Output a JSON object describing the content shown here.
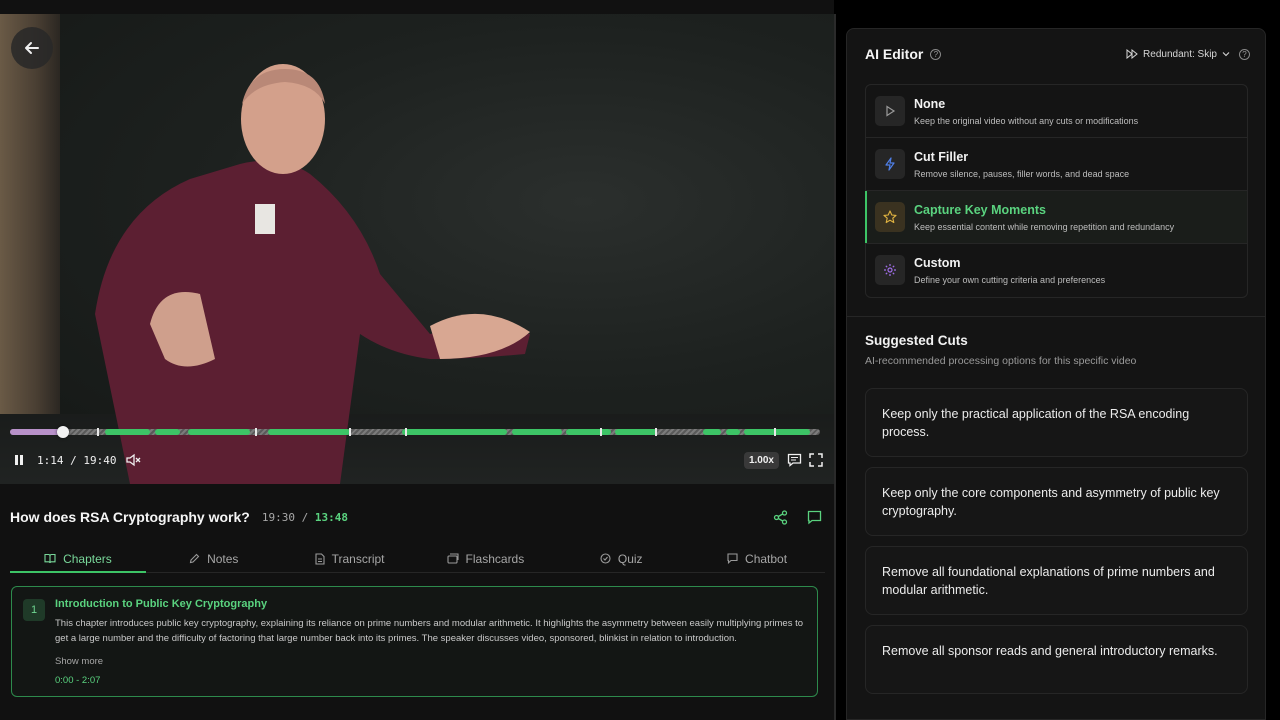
{
  "player": {
    "current_time": "1:14",
    "total_time": "19:40",
    "speed": "1.00x",
    "progress_fraction": 0.064,
    "colors": {
      "played": "#b891c9",
      "kept": "#3dc466",
      "cut": "#6b6b6b"
    }
  },
  "video": {
    "title": "How does RSA Cryptography work?",
    "original_duration": "19:30",
    "separator": "/",
    "edited_duration": "13:48"
  },
  "tabs": [
    {
      "label": "Chapters",
      "icon": "book-icon",
      "active": true
    },
    {
      "label": "Notes",
      "icon": "pencil-icon",
      "active": false
    },
    {
      "label": "Transcript",
      "icon": "document-icon",
      "active": false
    },
    {
      "label": "Flashcards",
      "icon": "cards-icon",
      "active": false
    },
    {
      "label": "Quiz",
      "icon": "check-circle-icon",
      "active": false
    },
    {
      "label": "Chatbot",
      "icon": "chat-icon",
      "active": false
    }
  ],
  "chapter": {
    "number": "1",
    "title": "Introduction to Public Key Cryptography",
    "description": "This chapter introduces public key cryptography, explaining its reliance on prime numbers and modular arithmetic. It highlights the asymmetry between easily multiplying primes to get a large number and the difficulty of factoring that large number back into its primes. The speaker discusses video, sponsored, blinkist in relation to introduction.",
    "show_more": "Show more",
    "range": "0:00 - 2:07"
  },
  "editor": {
    "title": "AI Editor",
    "redundant_label": "Redundant: Skip",
    "modes": [
      {
        "name": "None",
        "desc": "Keep the original video without any cuts or modifications",
        "icon": "play-icon",
        "color": "#9a9a9a",
        "active": false
      },
      {
        "name": "Cut Filler",
        "desc": "Remove silence, pauses, filler words, and dead space",
        "icon": "lightning-icon",
        "color": "#4f7fe8",
        "active": false
      },
      {
        "name": "Capture Key Moments",
        "desc": "Keep essential content while removing repetition and redundancy",
        "icon": "star-icon",
        "color": "#e0b341",
        "active": true
      },
      {
        "name": "Custom",
        "desc": "Define your own cutting criteria and preferences",
        "icon": "gear-icon",
        "color": "#a06ee8",
        "active": false
      }
    ]
  },
  "suggested": {
    "title": "Suggested Cuts",
    "subtitle": "AI-recommended processing options for this specific video",
    "items": [
      "Keep only the practical application of the RSA encoding process.",
      "Keep only the core components and asymmetry of public key cryptography.",
      "Remove all foundational explanations of prime numbers and modular arithmetic.",
      "Remove all sponsor reads and general introductory remarks."
    ]
  }
}
